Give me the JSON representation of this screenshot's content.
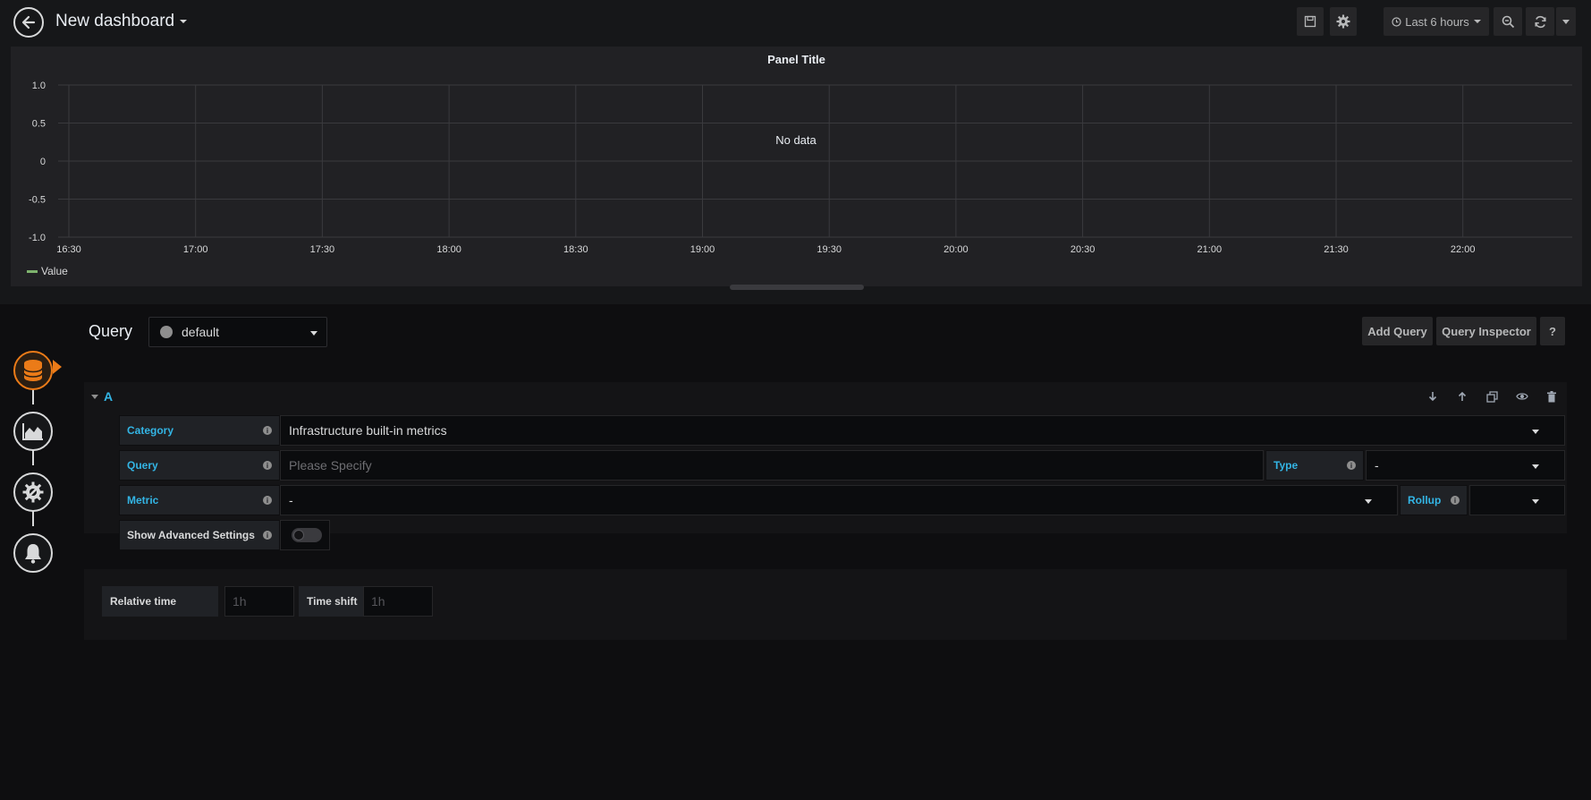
{
  "header": {
    "dashboard_title": "New dashboard",
    "time_range": "Last 6 hours"
  },
  "panel": {
    "title": "Panel Title",
    "no_data": "No data",
    "legend_label": "Value"
  },
  "chart_data": {
    "type": "line",
    "title": "Panel Title",
    "x_ticks": [
      "16:30",
      "17:00",
      "17:30",
      "18:00",
      "18:30",
      "19:00",
      "19:30",
      "20:00",
      "20:30",
      "21:00",
      "21:30",
      "22:00"
    ],
    "y_ticks": [
      "1.0",
      "0.5",
      "0",
      "-0.5",
      "-1.0"
    ],
    "ylim": [
      -1.0,
      1.0
    ],
    "grid": true,
    "legend_position": "bottom-left",
    "series": [
      {
        "name": "Value",
        "values": []
      }
    ],
    "no_data_text": "No data"
  },
  "editor": {
    "section_label": "Query",
    "datasource": "default",
    "add_query_label": "Add Query",
    "query_inspector_label": "Query Inspector",
    "help_label": "?",
    "query_row": {
      "letter": "A",
      "category_label": "Category",
      "category_value": "Infrastructure built-in metrics",
      "query_label": "Query",
      "query_placeholder": "Please Specify",
      "type_label": "Type",
      "type_value": "-",
      "metric_label": "Metric",
      "metric_value": "-",
      "rollup_label": "Rollup",
      "rollup_value": "",
      "advanced_label": "Show Advanced Settings"
    },
    "options": {
      "relative_time_label": "Relative time",
      "relative_time_placeholder": "1h",
      "time_shift_label": "Time shift",
      "time_shift_placeholder": "1h"
    }
  },
  "colors": {
    "accent": "#33b5e5",
    "active_step": "#eb7b18",
    "legend_series": "#7eb26d"
  }
}
